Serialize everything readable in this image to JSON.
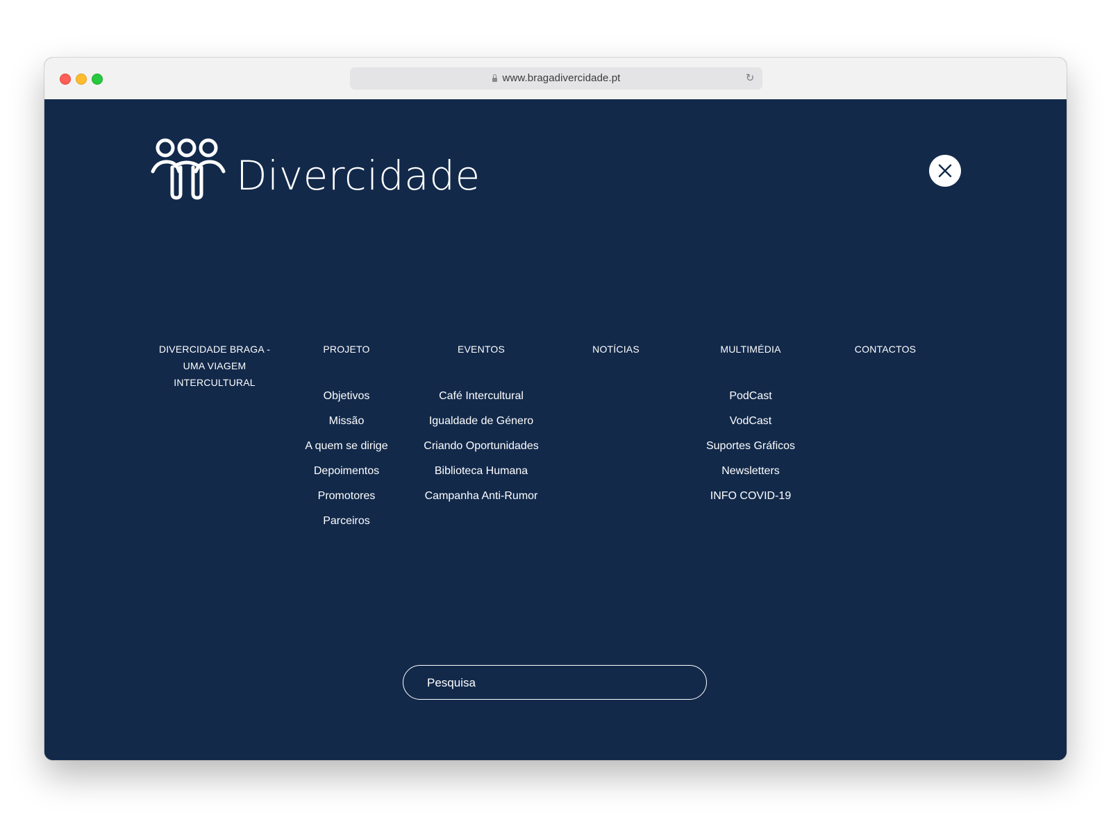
{
  "browser": {
    "url": "www.bragadivercidade.pt"
  },
  "brand": {
    "logo_text": "Divercidade"
  },
  "nav": {
    "columns": [
      {
        "label": "DIVERCIDADE BRAGA - UMA VIAGEM INTERCULTURAL",
        "items": []
      },
      {
        "label": "PROJETO",
        "items": [
          "Objetivos",
          "Missão",
          "A quem se dirige",
          "Depoimentos",
          "Promotores",
          "Parceiros"
        ]
      },
      {
        "label": "EVENTOS",
        "items": [
          "Café Intercultural",
          "Igualdade de Género",
          "Criando Oportunidades",
          "Biblioteca Humana",
          "Campanha Anti-Rumor"
        ]
      },
      {
        "label": "NOTÍCIAS",
        "items": []
      },
      {
        "label": "MULTIMÉDIA",
        "items": [
          "PodCast",
          "VodCast",
          "Suportes Gráficos",
          "Newsletters",
          "INFO COVID-19"
        ]
      },
      {
        "label": "CONTACTOS",
        "items": []
      }
    ]
  },
  "search": {
    "placeholder": "Pesquisa"
  },
  "icons": {
    "close": "close-icon",
    "lock": "lock-icon",
    "reload": "reload-icon",
    "logo": "people-logo-icon"
  },
  "colors": {
    "background": "#12294a",
    "text": "#ffffff"
  }
}
